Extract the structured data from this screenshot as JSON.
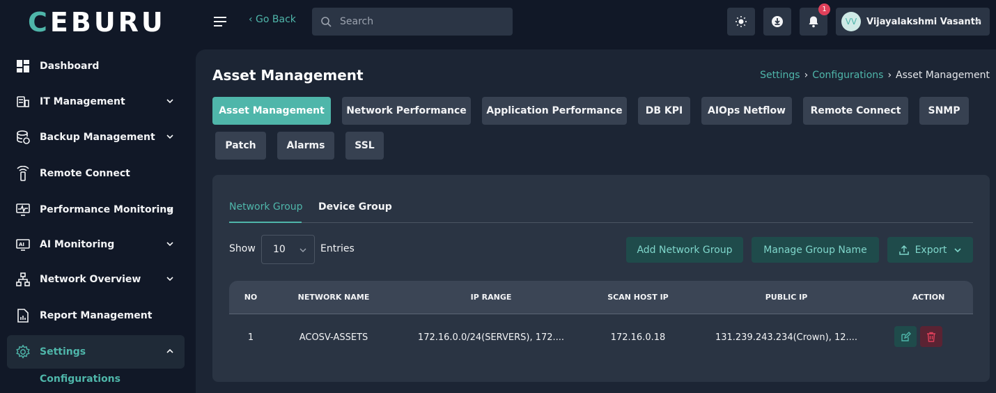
{
  "brand": {
    "logo_text_1": "C",
    "logo_text_2": "EBURU"
  },
  "sidebar": {
    "items": [
      {
        "label": "Dashboard",
        "icon": "dashboard-icon"
      },
      {
        "label": "IT Management",
        "icon": "server-icon",
        "expandable": true
      },
      {
        "label": "Backup Management",
        "icon": "database-backup-icon",
        "expandable": true
      },
      {
        "label": "Remote Connect",
        "icon": "antenna-icon"
      },
      {
        "label": "Performance Monitoring",
        "icon": "monitor-pulse-icon",
        "expandable": true
      },
      {
        "label": "AI Monitoring",
        "icon": "ai-monitor-icon",
        "expandable": true
      },
      {
        "label": "Network Overview",
        "icon": "network-icon",
        "expandable": true
      },
      {
        "label": "Report Management",
        "icon": "report-icon"
      },
      {
        "label": "Settings",
        "icon": "gear-icon",
        "expandable": true,
        "active": true
      }
    ],
    "sub_item": "Configurations"
  },
  "header": {
    "go_back": "‹ Go Back",
    "search_placeholder": "Search",
    "notification_count": "1",
    "user_initials": "VV",
    "user_name": "Vijayalakshmi Vasanth"
  },
  "page": {
    "title": "Asset Management",
    "breadcrumb": [
      "Settings",
      "Configurations",
      "Asset Management"
    ]
  },
  "module_tabs": [
    "Asset Management",
    "Network Performance",
    "Application Performance",
    "DB KPI",
    "AIOps Netflow",
    "Remote Connect",
    "SNMP",
    "Patch",
    "Alarms",
    "SSL"
  ],
  "sub_tabs": [
    "Network Group",
    "Device Group"
  ],
  "controls": {
    "show_label": "Show",
    "entries_value": "10",
    "entries_label": "Entries",
    "add_button": "Add Network Group",
    "manage_button": "Manage Group Name",
    "export_button": "Export"
  },
  "table": {
    "headers": [
      "NO",
      "NETWORK NAME",
      "IP RANGE",
      "SCAN HOST IP",
      "PUBLIC IP",
      "ACTION"
    ],
    "rows": [
      [
        "1",
        "ACOSV-ASSETS",
        "172.16.0.0/24(SERVERS), 172....",
        "172.16.0.18",
        "131.239.243.234(Crown), 12...."
      ]
    ]
  },
  "colors": {
    "accent": "#4fb6aa",
    "background": "#111827",
    "panel": "#1c2534",
    "card": "#2a3443",
    "danger": "#e0405a"
  }
}
